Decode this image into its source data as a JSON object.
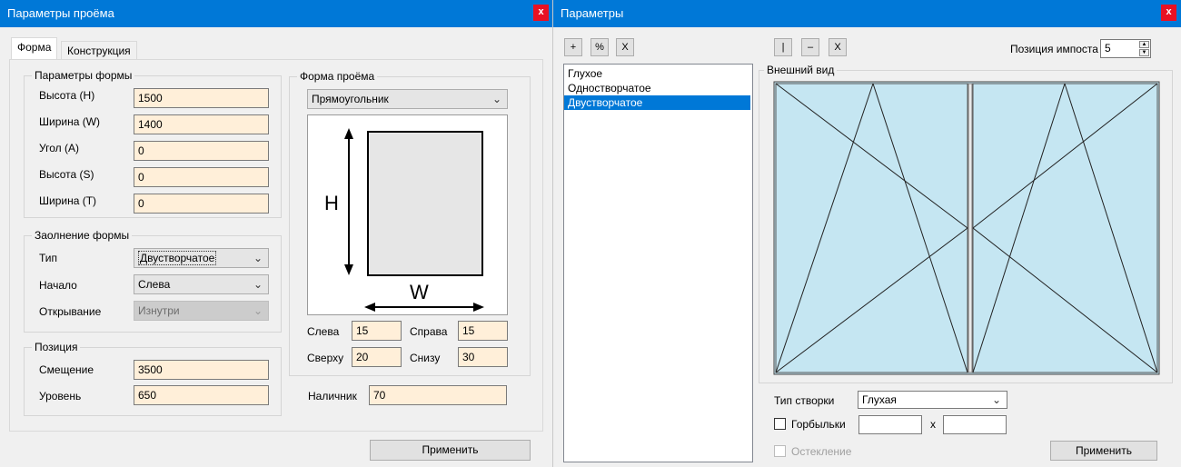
{
  "left_window": {
    "title": "Параметры проёма",
    "close": "x",
    "tabs": [
      {
        "label": "Форма",
        "active": true
      },
      {
        "label": "Конструкция",
        "active": false
      }
    ],
    "shape_params": {
      "title": "Параметры формы",
      "fields": [
        {
          "label": "Высота (H)",
          "value": "1500"
        },
        {
          "label": "Ширина (W)",
          "value": "1400"
        },
        {
          "label": "Угол (A)",
          "value": "0"
        },
        {
          "label": "Высота  (S)",
          "value": "0"
        },
        {
          "label": "Ширина (T)",
          "value": "0"
        }
      ]
    },
    "fill": {
      "title": "Заолнение формы",
      "type_label": "Тип",
      "type_value": "Двустворчатое",
      "start_label": "Начало",
      "start_value": "Слева",
      "opening_label": "Открывание",
      "opening_value": "Изнутри"
    },
    "position": {
      "title": "Позиция",
      "offset_label": "Смещение",
      "offset_value": "3500",
      "level_label": "Уровень",
      "level_value": "650"
    },
    "opening_shape": {
      "title": "Форма проёма",
      "shape_value": "Прямоугольник",
      "diagram_h": "H",
      "diagram_w": "W",
      "left_label": "Слева",
      "left_value": "15",
      "right_label": "Справа",
      "right_value": "15",
      "top_label": "Сверху",
      "top_value": "20",
      "bottom_label": "Снизу",
      "bottom_value": "30"
    },
    "casing_label": "Наличник",
    "casing_value": "70",
    "apply": "Применить"
  },
  "right_window": {
    "title": "Параметры",
    "close": "x",
    "toolbar_left": [
      "+",
      "%",
      "X"
    ],
    "toolbar_mid": [
      "|",
      "–",
      "X"
    ],
    "impost_label": "Позиция импоста",
    "impost_value": "5",
    "list_items": [
      {
        "label": "Глухое",
        "selected": false
      },
      {
        "label": "Одностворчатое",
        "selected": false
      },
      {
        "label": "Двустворчатое",
        "selected": true
      }
    ],
    "view_title": "Внешний вид",
    "sash_type_label": "Тип створки",
    "sash_type_value": "Глухая",
    "glazing_bars_label": "Горбыльки",
    "glazing_bars_x": "x",
    "glazing_label": "Остекление",
    "apply": "Применить",
    "glass_color": "#c5e6f2"
  }
}
